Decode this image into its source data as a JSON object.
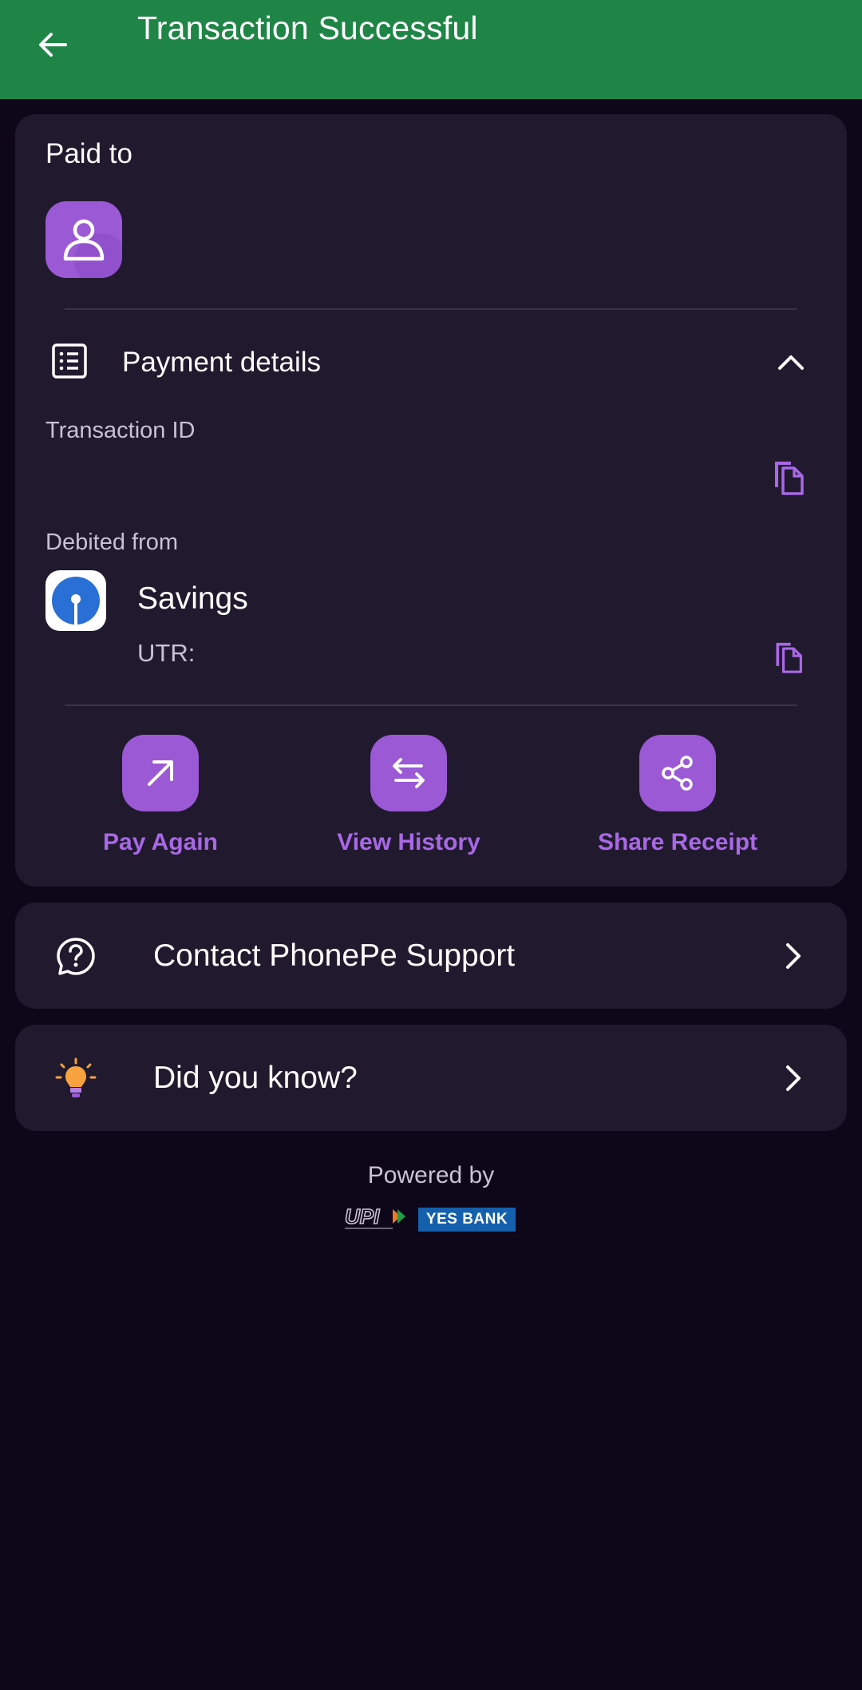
{
  "header": {
    "title": "Transaction Successful",
    "back_icon": "arrow-left-icon",
    "background_color": "#1f8546"
  },
  "paid_to": {
    "label": "Paid to",
    "avatar_icon": "person-icon"
  },
  "payment_details": {
    "label": "Payment details",
    "icon": "receipt-list-icon",
    "toggle_icon": "chevron-up-icon",
    "transaction_id_label": "Transaction ID",
    "transaction_id_value": "",
    "debited_from_label": "Debited from",
    "account_name": "Savings",
    "utr_label": "UTR:",
    "utr_value": "",
    "bank_icon": "sbi-logo-icon"
  },
  "actions": [
    {
      "label": "Pay Again",
      "icon": "arrow-up-right-icon"
    },
    {
      "label": "View History",
      "icon": "swap-arrows-icon"
    },
    {
      "label": "Share Receipt",
      "icon": "share-icon"
    }
  ],
  "support": {
    "label": "Contact PhonePe Support",
    "icon": "help-circle-icon"
  },
  "did_you_know": {
    "label": "Did you know?",
    "icon": "lightbulb-icon"
  },
  "footer": {
    "powered_by": "Powered by",
    "upi_logo_text": "UPI",
    "bank_logo_text": "YES BANK"
  },
  "colors": {
    "accent": "#9b59d6",
    "accent_text": "#a968e6",
    "card_background": "#211a2e",
    "page_background": "#0e0619"
  }
}
